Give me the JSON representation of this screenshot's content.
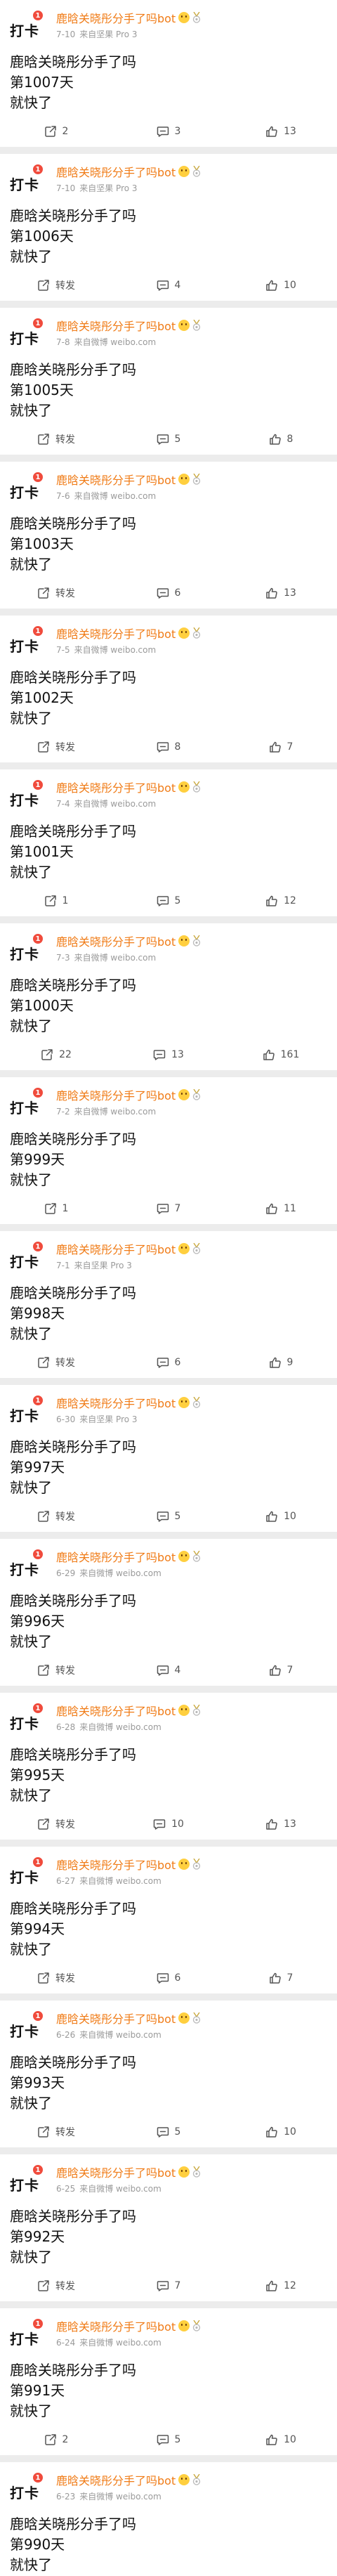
{
  "theme": {
    "username_color": "#f07b16",
    "badge_color": "#f04b3c",
    "background": "#ececec"
  },
  "posts": [
    {
      "avatar_text": "打卡",
      "badge": "1",
      "username": "鹿晗关晓彤分手了吗bot",
      "date": "7-10",
      "source": "来自坚果 Pro 3",
      "lines": [
        "鹿晗关晓彤分手了吗",
        "第1007天",
        "就快了"
      ],
      "repost": "2",
      "comments": "3",
      "likes": "13"
    },
    {
      "avatar_text": "打卡",
      "badge": "1",
      "username": "鹿晗关晓彤分手了吗bot",
      "date": "7-10",
      "source": "来自坚果 Pro 3",
      "lines": [
        "鹿晗关晓彤分手了吗",
        "第1006天",
        "就快了"
      ],
      "repost": "转发",
      "comments": "4",
      "likes": "10"
    },
    {
      "avatar_text": "打卡",
      "badge": "1",
      "username": "鹿晗关晓彤分手了吗bot",
      "date": "7-8",
      "source": "来自微博 weibo.com",
      "lines": [
        "鹿晗关晓彤分手了吗",
        "第1005天",
        "就快了"
      ],
      "repost": "转发",
      "comments": "5",
      "likes": "8"
    },
    {
      "avatar_text": "打卡",
      "badge": "1",
      "username": "鹿晗关晓彤分手了吗bot",
      "date": "7-6",
      "source": "来自微博 weibo.com",
      "lines": [
        "鹿晗关晓彤分手了吗",
        "第1003天",
        "就快了"
      ],
      "repost": "转发",
      "comments": "6",
      "likes": "13"
    },
    {
      "avatar_text": "打卡",
      "badge": "1",
      "username": "鹿晗关晓彤分手了吗bot",
      "date": "7-5",
      "source": "来自微博 weibo.com",
      "lines": [
        "鹿晗关晓彤分手了吗",
        "第1002天",
        "就快了"
      ],
      "repost": "转发",
      "comments": "8",
      "likes": "7"
    },
    {
      "avatar_text": "打卡",
      "badge": "1",
      "username": "鹿晗关晓彤分手了吗bot",
      "date": "7-4",
      "source": "来自微博 weibo.com",
      "lines": [
        "鹿晗关晓彤分手了吗",
        "第1001天",
        "就快了"
      ],
      "repost": "1",
      "comments": "5",
      "likes": "12"
    },
    {
      "avatar_text": "打卡",
      "badge": "1",
      "username": "鹿晗关晓彤分手了吗bot",
      "date": "7-3",
      "source": "来自微博 weibo.com",
      "lines": [
        "鹿晗关晓彤分手了吗",
        "第1000天",
        "就快了"
      ],
      "repost": "22",
      "comments": "13",
      "likes": "161"
    },
    {
      "avatar_text": "打卡",
      "badge": "1",
      "username": "鹿晗关晓彤分手了吗bot",
      "date": "7-2",
      "source": "来自微博 weibo.com",
      "lines": [
        "鹿晗关晓彤分手了吗",
        "第999天",
        "就快了"
      ],
      "repost": "1",
      "comments": "7",
      "likes": "11"
    },
    {
      "avatar_text": "打卡",
      "badge": "1",
      "username": "鹿晗关晓彤分手了吗bot",
      "date": "7-1",
      "source": "来自坚果 Pro 3",
      "lines": [
        "鹿晗关晓彤分手了吗",
        "第998天",
        "就快了"
      ],
      "repost": "转发",
      "comments": "6",
      "likes": "9"
    },
    {
      "avatar_text": "打卡",
      "badge": "1",
      "username": "鹿晗关晓彤分手了吗bot",
      "date": "6-30",
      "source": "来自坚果 Pro 3",
      "lines": [
        "鹿晗关晓彤分手了吗",
        "第997天",
        "就快了"
      ],
      "repost": "转发",
      "comments": "5",
      "likes": "10"
    },
    {
      "avatar_text": "打卡",
      "badge": "1",
      "username": "鹿晗关晓彤分手了吗bot",
      "date": "6-29",
      "source": "来自微博 weibo.com",
      "lines": [
        "鹿晗关晓彤分手了吗",
        "第996天",
        "就快了"
      ],
      "repost": "转发",
      "comments": "4",
      "likes": "7"
    },
    {
      "avatar_text": "打卡",
      "badge": "1",
      "username": "鹿晗关晓彤分手了吗bot",
      "date": "6-28",
      "source": "来自微博 weibo.com",
      "lines": [
        "鹿晗关晓彤分手了吗",
        "第995天",
        "就快了"
      ],
      "repost": "转发",
      "comments": "10",
      "likes": "13"
    },
    {
      "avatar_text": "打卡",
      "badge": "1",
      "username": "鹿晗关晓彤分手了吗bot",
      "date": "6-27",
      "source": "来自微博 weibo.com",
      "lines": [
        "鹿晗关晓彤分手了吗",
        "第994天",
        "就快了"
      ],
      "repost": "转发",
      "comments": "6",
      "likes": "7"
    },
    {
      "avatar_text": "打卡",
      "badge": "1",
      "username": "鹿晗关晓彤分手了吗bot",
      "date": "6-26",
      "source": "来自微博 weibo.com",
      "lines": [
        "鹿晗关晓彤分手了吗",
        "第993天",
        "就快了"
      ],
      "repost": "转发",
      "comments": "5",
      "likes": "10"
    },
    {
      "avatar_text": "打卡",
      "badge": "1",
      "username": "鹿晗关晓彤分手了吗bot",
      "date": "6-25",
      "source": "来自微博 weibo.com",
      "lines": [
        "鹿晗关晓彤分手了吗",
        "第992天",
        "就快了"
      ],
      "repost": "转发",
      "comments": "7",
      "likes": "12"
    },
    {
      "avatar_text": "打卡",
      "badge": "1",
      "username": "鹿晗关晓彤分手了吗bot",
      "date": "6-24",
      "source": "来自微博 weibo.com",
      "lines": [
        "鹿晗关晓彤分手了吗",
        "第991天",
        "就快了"
      ],
      "repost": "2",
      "comments": "5",
      "likes": "10"
    },
    {
      "avatar_text": "打卡",
      "badge": "1",
      "username": "鹿晗关晓彤分手了吗bot",
      "date": "6-23",
      "source": "来自微博 weibo.com",
      "lines": [
        "鹿晗关晓彤分手了吗",
        "第990天",
        "就快了"
      ],
      "repost": null,
      "comments": null,
      "likes": null
    }
  ]
}
